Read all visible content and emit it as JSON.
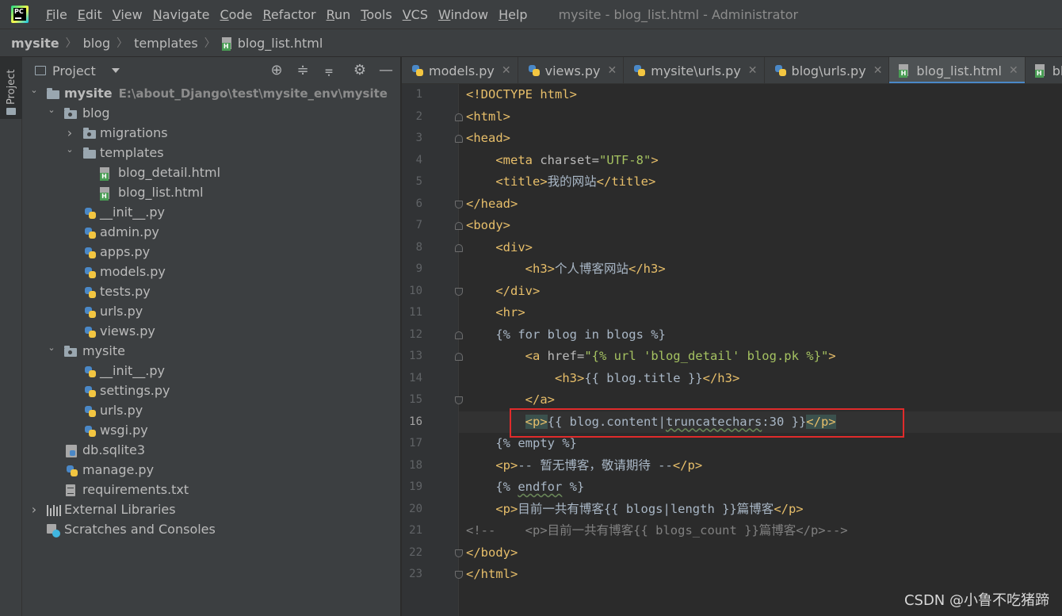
{
  "menubar": {
    "items": [
      {
        "label": "File",
        "mnemonic": "F",
        "rest": "ile"
      },
      {
        "label": "Edit",
        "mnemonic": "E",
        "rest": "dit"
      },
      {
        "label": "View",
        "mnemonic": "V",
        "rest": "iew"
      },
      {
        "label": "Navigate",
        "mnemonic": "N",
        "rest": "avigate"
      },
      {
        "label": "Code",
        "mnemonic": "C",
        "rest": "ode"
      },
      {
        "label": "Refactor",
        "mnemonic": "R",
        "rest": "efactor"
      },
      {
        "label": "Run",
        "mnemonic": "R",
        "rest": "un"
      },
      {
        "label": "Tools",
        "mnemonic": "T",
        "rest": "ools"
      },
      {
        "label": "VCS",
        "mnemonic": "V",
        "rest": "CS"
      },
      {
        "label": "Window",
        "mnemonic": "W",
        "rest": "indow"
      },
      {
        "label": "Help",
        "mnemonic": "H",
        "rest": "elp"
      }
    ],
    "window_title": "mysite - blog_list.html - Administrator",
    "logo_text": "PC"
  },
  "breadcrumb": [
    "mysite",
    "blog",
    "templates",
    "blog_list.html"
  ],
  "toolstrip": {
    "project_tab": "Project"
  },
  "project_panel": {
    "title": "Project",
    "tree": [
      {
        "label": "mysite",
        "extra": "E:\\about_Django\\test\\mysite_env\\mysite",
        "icon": "folder",
        "arrow": "expanded",
        "depth": 0,
        "bold": true
      },
      {
        "label": "blog",
        "icon": "package",
        "arrow": "expanded",
        "depth": 1
      },
      {
        "label": "migrations",
        "icon": "package",
        "arrow": "collapsed",
        "depth": 2
      },
      {
        "label": "templates",
        "icon": "folder",
        "arrow": "expanded",
        "depth": 2
      },
      {
        "label": "blog_detail.html",
        "icon": "html",
        "depth": 3
      },
      {
        "label": "blog_list.html",
        "icon": "html",
        "depth": 3
      },
      {
        "label": "__init__.py",
        "icon": "python",
        "depth": 2
      },
      {
        "label": "admin.py",
        "icon": "python",
        "depth": 2
      },
      {
        "label": "apps.py",
        "icon": "python",
        "depth": 2
      },
      {
        "label": "models.py",
        "icon": "python",
        "depth": 2
      },
      {
        "label": "tests.py",
        "icon": "python",
        "depth": 2
      },
      {
        "label": "urls.py",
        "icon": "python",
        "depth": 2
      },
      {
        "label": "views.py",
        "icon": "python",
        "depth": 2
      },
      {
        "label": "mysite",
        "icon": "package",
        "arrow": "expanded",
        "depth": 1
      },
      {
        "label": "__init__.py",
        "icon": "python",
        "depth": 2
      },
      {
        "label": "settings.py",
        "icon": "python",
        "depth": 2
      },
      {
        "label": "urls.py",
        "icon": "python",
        "depth": 2
      },
      {
        "label": "wsgi.py",
        "icon": "python",
        "depth": 2
      },
      {
        "label": "db.sqlite3",
        "icon": "database",
        "depth": 1
      },
      {
        "label": "manage.py",
        "icon": "python",
        "depth": 1
      },
      {
        "label": "requirements.txt",
        "icon": "text",
        "depth": 1
      },
      {
        "label": "External Libraries",
        "icon": "libraries",
        "arrow": "collapsed",
        "depth": 0
      },
      {
        "label": "Scratches and Consoles",
        "icon": "scratches",
        "depth": 0
      }
    ]
  },
  "tabs": [
    {
      "label": "models.py",
      "icon": "python",
      "active": false
    },
    {
      "label": "views.py",
      "icon": "python",
      "active": false
    },
    {
      "label": "mysite\\urls.py",
      "icon": "python",
      "active": false
    },
    {
      "label": "blog\\urls.py",
      "icon": "python",
      "active": false
    },
    {
      "label": "blog_list.html",
      "icon": "html",
      "active": true
    },
    {
      "label": "blog_de",
      "icon": "html",
      "active": false
    }
  ],
  "editor": {
    "current_line": 16,
    "lines": [
      [
        [
          "t-tag",
          "<!DOCTYPE html>"
        ]
      ],
      [
        [
          "t-tag",
          "<html>"
        ]
      ],
      [
        [
          "t-tag",
          "<head>"
        ]
      ],
      [
        [
          "",
          "    "
        ],
        [
          "t-tag",
          "<meta "
        ],
        [
          "t-attr",
          "charset="
        ],
        [
          "t-str",
          "\"UTF-8\""
        ],
        [
          "t-tag",
          ">"
        ]
      ],
      [
        [
          "",
          "    "
        ],
        [
          "t-tag",
          "<title>"
        ],
        [
          "t-tpl",
          "我的网站"
        ],
        [
          "t-tag",
          "</title>"
        ]
      ],
      [
        [
          "t-tag",
          "</head>"
        ]
      ],
      [
        [
          "t-tag",
          "<body>"
        ]
      ],
      [
        [
          "",
          "    "
        ],
        [
          "t-tag",
          "<div>"
        ]
      ],
      [
        [
          "",
          "        "
        ],
        [
          "t-tag",
          "<h3>"
        ],
        [
          "t-tpl",
          "个人博客网站"
        ],
        [
          "t-tag",
          "</h3>"
        ]
      ],
      [
        [
          "",
          "    "
        ],
        [
          "t-tag",
          "</div>"
        ]
      ],
      [
        [
          "",
          "    "
        ],
        [
          "t-tag",
          "<hr>"
        ]
      ],
      [
        [
          "",
          "    "
        ],
        [
          "t-tpl",
          "{% for blog in blogs %}"
        ]
      ],
      [
        [
          "",
          "        "
        ],
        [
          "t-tag",
          "<a "
        ],
        [
          "t-attr",
          "href="
        ],
        [
          "t-str",
          "\"{% url 'blog_detail' blog.pk %}\""
        ],
        [
          "t-tag",
          ">"
        ]
      ],
      [
        [
          "",
          "            "
        ],
        [
          "t-tag",
          "<h3>"
        ],
        [
          "t-tpl",
          "{{ blog.title }}"
        ],
        [
          "t-tag",
          "</h3>"
        ]
      ],
      [
        [
          "",
          "        "
        ],
        [
          "t-tag",
          "</a>"
        ]
      ],
      [
        [
          "",
          "        "
        ],
        [
          "t-tag t-hl",
          "<p>"
        ],
        [
          "t-tpl",
          "{{ blog.content|"
        ],
        [
          "t-tpl t-wavy",
          "truncatechars"
        ],
        [
          "t-tpl",
          ":30 }}"
        ],
        [
          "t-tag t-hl",
          "</p>"
        ]
      ],
      [
        [
          "",
          "    "
        ],
        [
          "t-tpl",
          "{% empty %}"
        ]
      ],
      [
        [
          "",
          "    "
        ],
        [
          "t-tag",
          "<p>"
        ],
        [
          "t-tpl",
          "-- 暂无博客，敬请期待 --"
        ],
        [
          "t-tag",
          "</p>"
        ]
      ],
      [
        [
          "",
          "    "
        ],
        [
          "t-tpl",
          "{% "
        ],
        [
          "t-tpl t-wavy",
          "endfor"
        ],
        [
          "t-tpl",
          " %}"
        ]
      ],
      [
        [
          "",
          "    "
        ],
        [
          "t-tag",
          "<p>"
        ],
        [
          "t-tpl",
          "目前一共有博客{{ blogs|length }}篇博客"
        ],
        [
          "t-tag",
          "</p>"
        ]
      ],
      [
        [
          "t-cmt",
          "<!--    <p>目前一共有博客{{ blogs_count }}篇博客</p>-->"
        ]
      ],
      [
        [
          "t-tag",
          "</body>"
        ]
      ],
      [
        [
          "t-tag",
          "</html>"
        ]
      ]
    ],
    "folds": [
      {
        "line": 2,
        "kind": "open"
      },
      {
        "line": 3,
        "kind": "open"
      },
      {
        "line": 6,
        "kind": "close"
      },
      {
        "line": 7,
        "kind": "open"
      },
      {
        "line": 8,
        "kind": "open"
      },
      {
        "line": 10,
        "kind": "close"
      },
      {
        "line": 12,
        "kind": "open"
      },
      {
        "line": 13,
        "kind": "open"
      },
      {
        "line": 15,
        "kind": "close"
      },
      {
        "line": 22,
        "kind": "close"
      },
      {
        "line": 23,
        "kind": "close"
      }
    ]
  },
  "watermark": "CSDN @小鲁不吃猪蹄",
  "colors": {
    "accent": "#4a88c7",
    "annotation_box": "#e02b2b",
    "tag": "#e8bf6a",
    "string": "#a5c261"
  }
}
